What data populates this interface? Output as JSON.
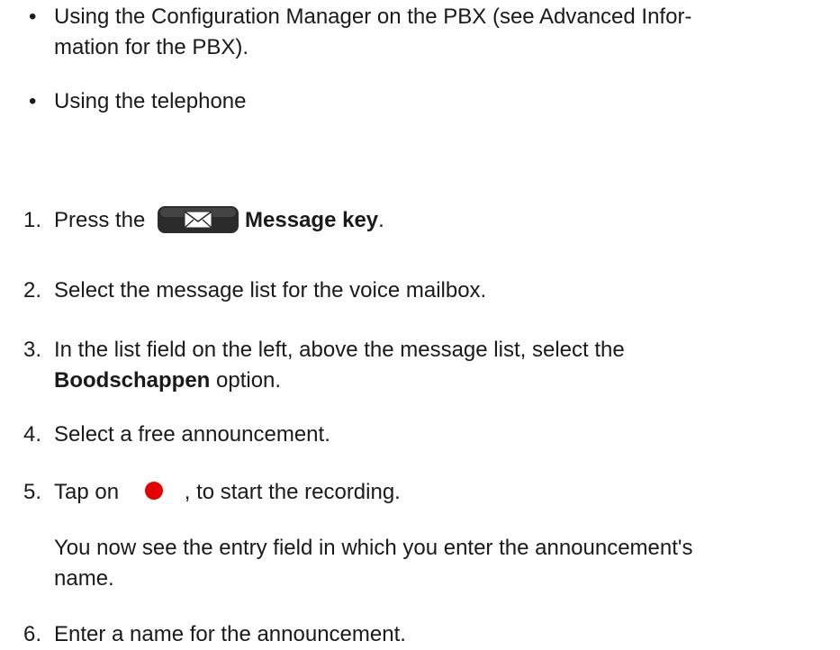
{
  "bullets": [
    {
      "marker": "•",
      "text": "Using the Configuration Manager on the PBX (see Advanced Infor-",
      "text_cont": "mation for the PBX)."
    },
    {
      "marker": "•",
      "text": "Using the telephone"
    }
  ],
  "steps": [
    {
      "num": "1.",
      "pre": "Press the",
      "bold": "Message key",
      "post": ".",
      "icon": "envelope-key-icon"
    },
    {
      "num": "2.",
      "text": "Select the message list for the voice mailbox."
    },
    {
      "num": "3.",
      "text": "In the list field on the left, above the message list, select the",
      "bold": "Boodschappen",
      "post": " option."
    },
    {
      "num": "4.",
      "text": "Select a free announcement."
    },
    {
      "num": "5.",
      "pre": "Tap on",
      "post": ", to start the recording.",
      "icon": "record-icon",
      "note": "You now see the entry field in which you enter the announcement's",
      "note_cont": "name."
    },
    {
      "num": "6.",
      "text": "Enter a name for the announcement."
    }
  ],
  "colors": {
    "text": "#1a1a1a",
    "record": "#e60000",
    "key_body": "#2b2b2b"
  }
}
